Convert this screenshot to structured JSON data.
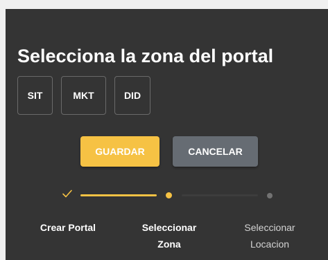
{
  "title": "Selecciona la zona del portal",
  "zones": [
    {
      "label": "SIT"
    },
    {
      "label": "MKT"
    },
    {
      "label": "DID"
    }
  ],
  "actions": {
    "save_label": "GUARDAR",
    "cancel_label": "CANCELAR"
  },
  "stepper": {
    "steps": [
      {
        "label": "Crear Portal",
        "state": "completed",
        "icon": "check-icon"
      },
      {
        "label": "Seleccionar Zona",
        "state": "active",
        "icon": "dot"
      },
      {
        "label": "Seleccionar Locacion",
        "state": "pending",
        "icon": "dot"
      }
    ]
  },
  "colors": {
    "panel_background": "#343434",
    "accent": "#f6c244",
    "cancel": "#666c73"
  }
}
